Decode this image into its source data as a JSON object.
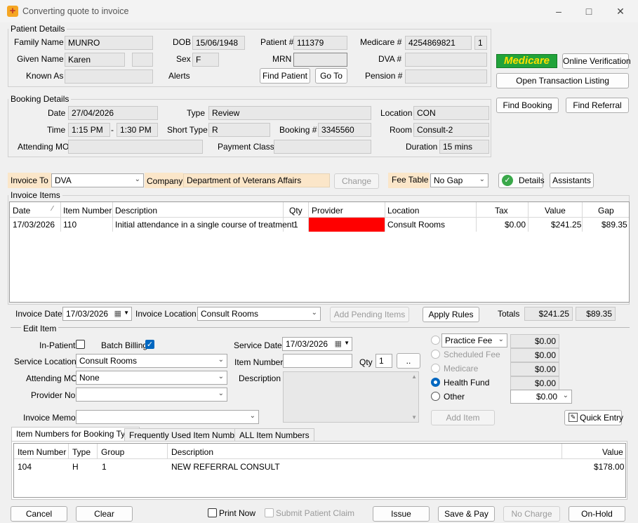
{
  "window": {
    "title": "Converting quote to invoice"
  },
  "patient": {
    "section_title": "Patient Details",
    "family_name_label": "Family Name",
    "family_name": "MUNRO",
    "given_name_label": "Given Name",
    "given_name": "Karen",
    "known_as_label": "Known As",
    "dob_label": "DOB",
    "dob": "15/06/1948",
    "sex_label": "Sex",
    "sex": "F",
    "alerts_label": "Alerts",
    "patient_no_label": "Patient #",
    "patient_no": "111379",
    "mrn_label": "MRN",
    "medicare_label": "Medicare #",
    "medicare_no": "4254869821",
    "medicare_irn": "1",
    "dva_label": "DVA #",
    "pension_label": "Pension #",
    "find_patient": "Find Patient",
    "go_to": "Go To"
  },
  "side": {
    "medicare_logo": "Medicare",
    "online_verification": "Online Verification",
    "open_transaction_listing": "Open Transaction Listing",
    "find_booking": "Find Booking",
    "find_referral": "Find Referral"
  },
  "booking": {
    "section_title": "Booking Details",
    "date_label": "Date",
    "date": "27/04/2026",
    "time_label": "Time",
    "time_start": "1:15 PM",
    "time_sep": "-",
    "time_end": "1:30 PM",
    "attending_mo_label": "Attending MO",
    "type_label": "Type",
    "type": "Review",
    "short_type_label": "Short Type",
    "short_type": "R",
    "booking_no_label": "Booking #",
    "booking_no": "3345560",
    "payment_class_label": "Payment Class",
    "location_label": "Location",
    "location": "CON",
    "room_label": "Room",
    "room": "Consult-2",
    "duration_label": "Duration",
    "duration": "15 mins"
  },
  "invoice_to": {
    "label": "Invoice To",
    "value": "DVA",
    "company_label": "Company",
    "company": "Department of Veterans Affairs",
    "change": "Change",
    "fee_table_label": "Fee Table",
    "fee_table": "No Gap",
    "details": "Details",
    "assistants": "Assistants"
  },
  "invoice_items": {
    "section_title": "Invoice Items",
    "columns": [
      "Date",
      "Item Number",
      "Description",
      "Qty",
      "Provider",
      "Location",
      "Tax",
      "Value",
      "Gap"
    ],
    "rows": [
      {
        "date": "17/03/2026",
        "item_number": "110",
        "description": "Initial attendance in a single course of treatment",
        "qty": "1",
        "provider": "",
        "location": "Consult Rooms",
        "tax": "$0.00",
        "value": "$241.25",
        "gap": "$89.35"
      }
    ],
    "provider_missing_color": "#ff0000"
  },
  "invoice_footer": {
    "invoice_date_label": "Invoice Date",
    "invoice_date": "17/03/2026",
    "invoice_location_label": "Invoice Location",
    "invoice_location": "Consult Rooms",
    "add_pending_items": "Add Pending Items",
    "apply_rules": "Apply Rules",
    "totals_label": "Totals",
    "total_value": "$241.25",
    "total_gap": "$89.35"
  },
  "edit_item": {
    "section_title": "Edit Item",
    "in_patient_label": "In-Patient",
    "batch_billing_label": "Batch Billing",
    "service_location_label": "Service Location",
    "service_location": "Consult Rooms",
    "attending_mo_label": "Attending MO",
    "attending_mo": "None",
    "provider_no_label": "Provider No",
    "invoice_memo_label": "Invoice Memo",
    "service_date_label": "Service Date",
    "service_date": "17/03/2026",
    "item_number_label": "Item Number",
    "qty_label": "Qty",
    "qty": "1",
    "qty_button": "..",
    "description_label": "Description",
    "fees": {
      "practice_fee": "Practice Fee",
      "practice_fee_value": "$0.00",
      "scheduled_fee": "Scheduled Fee",
      "scheduled_fee_value": "$0.00",
      "medicare": "Medicare",
      "medicare_value": "$0.00",
      "health_fund": "Health Fund",
      "health_fund_value": "$0.00",
      "other": "Other",
      "other_value": "$0.00"
    },
    "add_item": "Add Item",
    "quick_entry": "Quick Entry"
  },
  "item_tabs": {
    "tabs": [
      "Item Numbers for Booking Type",
      "Frequently Used Item Numbers",
      "ALL Item Numbers"
    ],
    "columns": [
      "Item Number",
      "Type",
      "Group",
      "Description",
      "Value"
    ],
    "rows": [
      {
        "item_number": "104",
        "type": "H",
        "group": "1",
        "description": "NEW REFERRAL CONSULT",
        "value": "$178.00"
      }
    ]
  },
  "bottom": {
    "cancel": "Cancel",
    "clear": "Clear",
    "print_now": "Print Now",
    "submit_patient_claim": "Submit Patient Claim",
    "issue": "Issue",
    "save_pay": "Save & Pay",
    "no_charge": "No Charge",
    "on_hold": "On-Hold"
  }
}
